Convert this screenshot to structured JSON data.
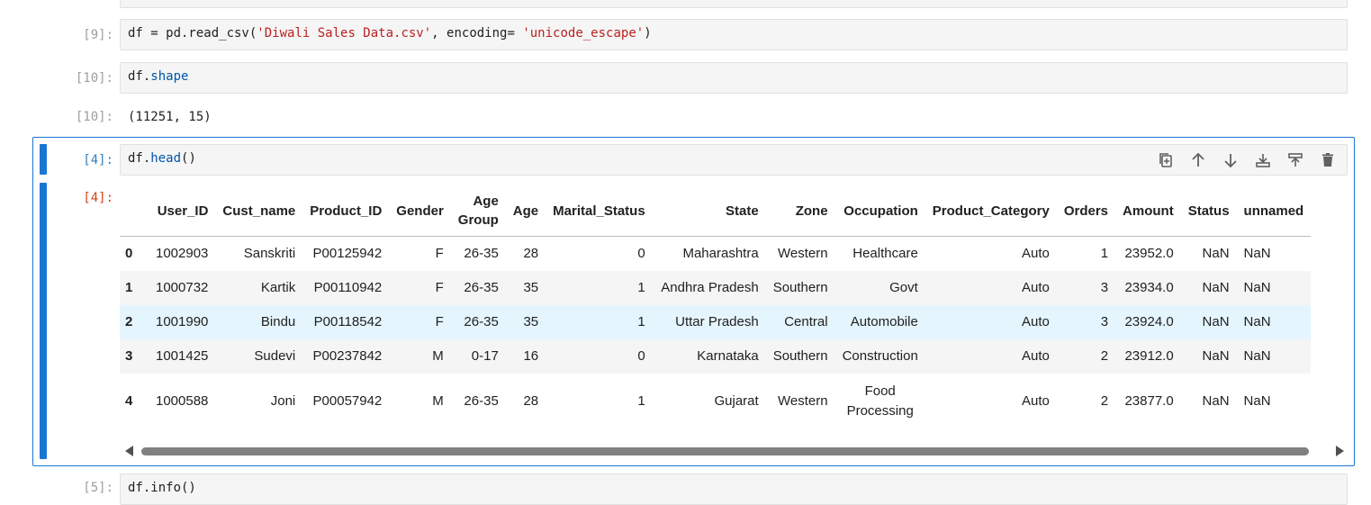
{
  "cells": [
    {
      "prompt": "[9]:",
      "code": [
        "df = pd.read_csv(",
        "'Diwali Sales Data.csv'",
        ", encoding= ",
        "'unicode_escape'",
        ")"
      ]
    },
    {
      "prompt": "[10]:",
      "code": [
        "df.",
        "shape"
      ]
    },
    {
      "out_prompt": "[10]:",
      "output": "(11251, 15)"
    },
    {
      "prompt": "[4]:",
      "code": [
        "df.",
        "head",
        "()"
      ],
      "out_prompt": "[4]:"
    },
    {
      "prompt": "[5]:",
      "code": "df.info()"
    }
  ],
  "toolbar": {
    "icons": [
      "duplicate-icon",
      "move-up-icon",
      "move-down-icon",
      "insert-below-icon",
      "insert-above-icon",
      "delete-icon"
    ]
  },
  "table": {
    "columns": [
      "",
      "User_ID",
      "Cust_name",
      "Product_ID",
      "Gender",
      "Age\nGroup",
      "Age",
      "Marital_Status",
      "State",
      "Zone",
      "Occupation",
      "Product_Category",
      "Orders",
      "Amount",
      "Status",
      "unnamed"
    ],
    "rows": [
      [
        "0",
        "1002903",
        "Sanskriti",
        "P00125942",
        "F",
        "26-35",
        "28",
        "0",
        "Maharashtra",
        "Western",
        "Healthcare",
        "Auto",
        "1",
        "23952.0",
        "NaN",
        "NaN"
      ],
      [
        "1",
        "1000732",
        "Kartik",
        "P00110942",
        "F",
        "26-35",
        "35",
        "1",
        "Andhra Pradesh",
        "Southern",
        "Govt",
        "Auto",
        "3",
        "23934.0",
        "NaN",
        "NaN"
      ],
      [
        "2",
        "1001990",
        "Bindu",
        "P00118542",
        "F",
        "26-35",
        "35",
        "1",
        "Uttar Pradesh",
        "Central",
        "Automobile",
        "Auto",
        "3",
        "23924.0",
        "NaN",
        "NaN"
      ],
      [
        "3",
        "1001425",
        "Sudevi",
        "P00237842",
        "M",
        "0-17",
        "16",
        "0",
        "Karnataka",
        "Southern",
        "Construction",
        "Auto",
        "2",
        "23912.0",
        "NaN",
        "NaN"
      ],
      [
        "4",
        "1000588",
        "Joni",
        "P00057942",
        "M",
        "26-35",
        "28",
        "1",
        "Gujarat",
        "Western",
        "Food\nProcessing",
        "Auto",
        "2",
        "23877.0",
        "NaN",
        "NaN"
      ]
    ]
  },
  "scrollbar": {
    "position": 0.0,
    "visible_fraction": 0.95
  }
}
